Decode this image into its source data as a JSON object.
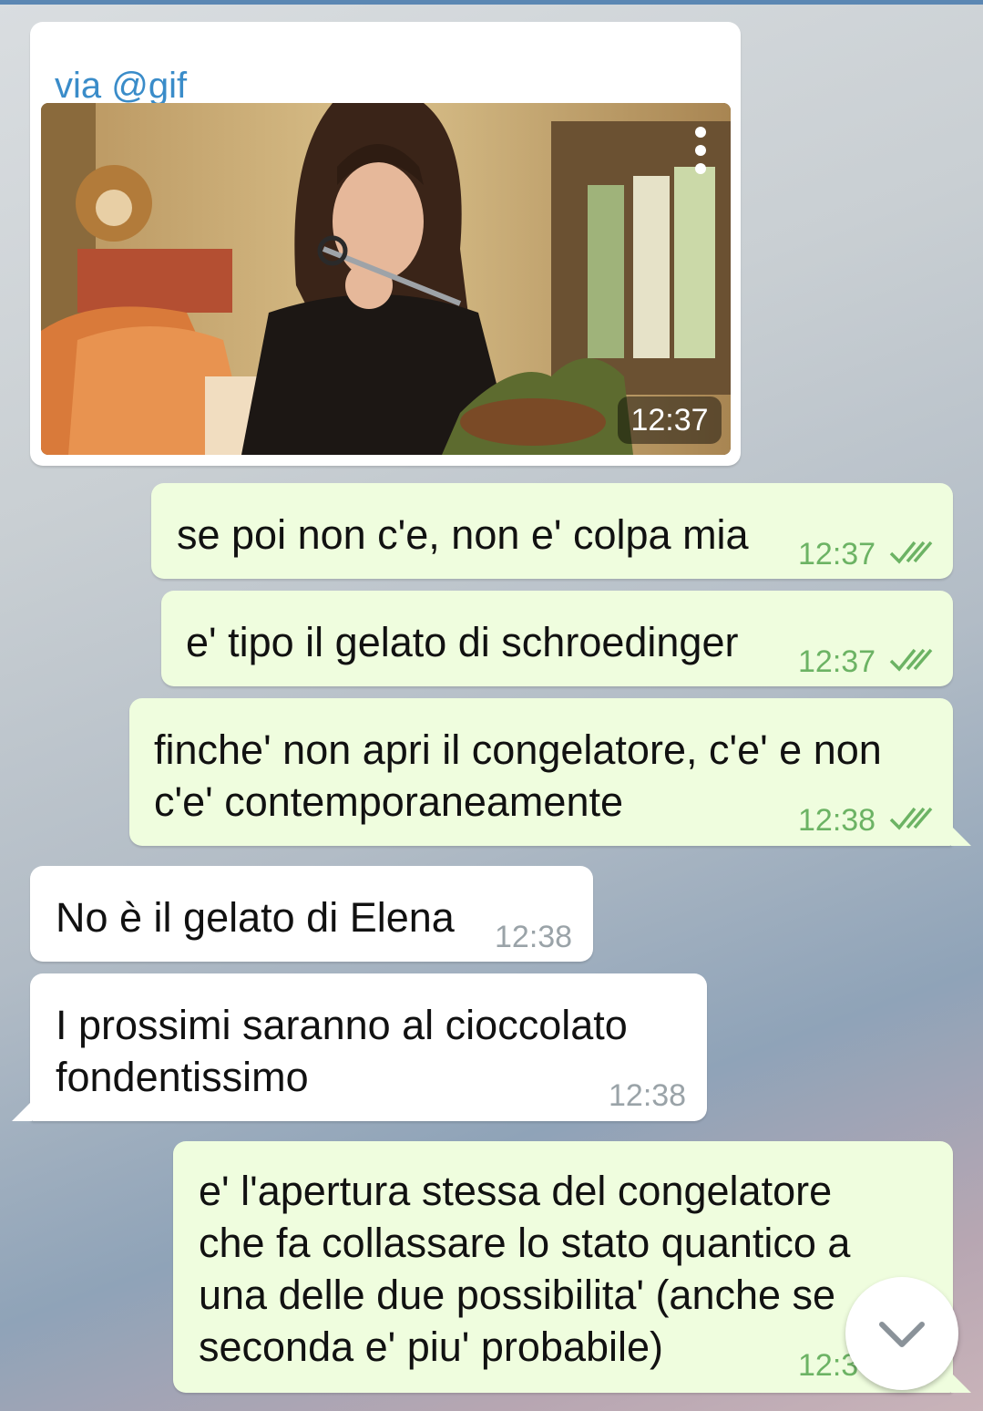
{
  "gif_message": {
    "via_label": "via @gif",
    "time": "12:37",
    "menu_icon": "more-vertical-icon"
  },
  "messages": [
    {
      "direction": "outgoing",
      "text": "se poi non c'e, non e' colpa mia",
      "time": "12:37",
      "status": "read"
    },
    {
      "direction": "outgoing",
      "text": "e' tipo il gelato di schroedinger",
      "time": "12:37",
      "status": "read"
    },
    {
      "direction": "outgoing",
      "text": "finche' non apri il congelatore, c'e' e non\nc'e' contemporaneamente",
      "time": "12:38",
      "status": "read"
    },
    {
      "direction": "incoming",
      "text": "No è il gelato di Elena",
      "time": "12:38"
    },
    {
      "direction": "incoming",
      "text": "I prossimi saranno al cioccolato\nfondentissimo",
      "time": "12:38"
    },
    {
      "direction": "outgoing",
      "text": "e' l'apertura stessa del congelatore\nche fa collassare lo stato quantico a\nuna delle due possibilita' (anche se\nseconda e' piu' probabile)",
      "time": "12:3",
      "status": "read"
    }
  ],
  "scroll_button": {
    "icon": "chevron-down-icon"
  },
  "colors": {
    "incoming_bubble": "#ffffff",
    "outgoing_bubble": "#effdde",
    "outgoing_time": "#6cb364",
    "incoming_time": "#9aa3a8",
    "via_link": "#3a8cc9",
    "read_ticks": "#6cb364"
  }
}
